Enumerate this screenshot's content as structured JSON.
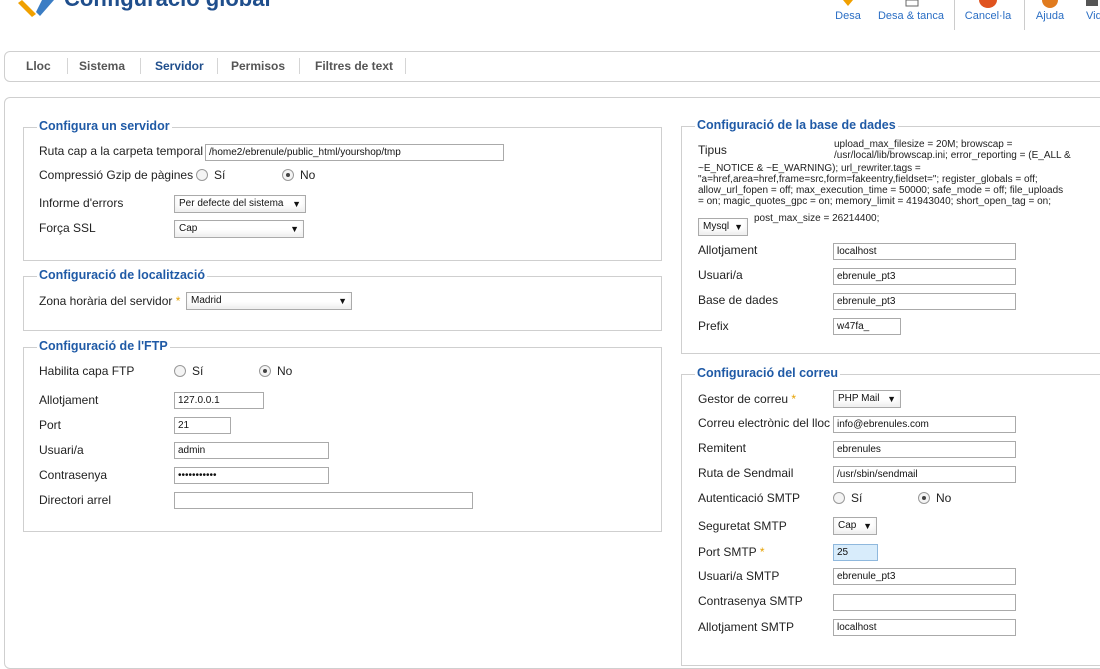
{
  "header": {
    "title": "Configuració global",
    "toolbar": {
      "save": "Desa",
      "save_close": "Desa & tanca",
      "cancel": "Cancel·la",
      "help": "Ajuda",
      "video": "Vid"
    }
  },
  "tabs": [
    "Lloc",
    "Sistema",
    "Servidor",
    "Permisos",
    "Filtres de text"
  ],
  "active_tab": "Servidor",
  "server": {
    "legend": "Configura un servidor",
    "tmp_path_label": "Ruta cap a la carpeta temporal",
    "tmp_path_value": "/home2/ebrenule/public_html/yourshop/tmp",
    "gzip_label": "Compressió Gzip de pàgines",
    "gzip_yes": "Sí",
    "gzip_no": "No",
    "gzip_selected": "No",
    "errors_label": "Informe d'errors",
    "errors_value": "Per defecte del sistema",
    "ssl_label": "Força SSL",
    "ssl_value": "Cap"
  },
  "locale": {
    "legend": "Configuració de localització",
    "tz_label": "Zona horària del servidor",
    "tz_value": "Madrid"
  },
  "ftp": {
    "legend": "Configuració de l'FTP",
    "enable_label": "Habilita capa FTP",
    "yes": "Sí",
    "no": "No",
    "selected": "No",
    "host_label": "Allotjament",
    "host_value": "127.0.0.1",
    "port_label": "Port",
    "port_value": "21",
    "user_label": "Usuari/a",
    "user_value": "admin",
    "pass_label": "Contrasenya",
    "pass_value": "•••••••••••",
    "root_label": "Directori arrel",
    "root_value": ""
  },
  "database": {
    "legend": "Configuració de la base de dades",
    "type_label": "Tipus",
    "type_info_1": "upload_max_filesize = 20M; browscap =",
    "type_info_2": "/usr/local/lib/browscap.ini; error_reporting = (E_ALL &",
    "type_info_3": "~E_NOTICE & ~E_WARNING); url_rewriter.tags =",
    "type_info_4": "\"a=href,area=href,frame=src,form=fakeentry,fieldset=\"; register_globals = off;",
    "type_info_5": "allow_url_fopen = off; max_execution_time = 50000; safe_mode = off; file_uploads",
    "type_info_6": "= on; magic_quotes_gpc = on; memory_limit = 41943040; short_open_tag = on;",
    "type_info_7": "post_max_size = 26214400;",
    "type_value": "Mysql",
    "host_label": "Allotjament",
    "host_value": "localhost",
    "user_label": "Usuari/a",
    "user_value": "ebrenule_pt3",
    "db_label": "Base de dades",
    "db_value": "ebrenule_pt3",
    "prefix_label": "Prefix",
    "prefix_value": "w47fa_"
  },
  "mail": {
    "legend": "Configuració del correu",
    "mailer_label": "Gestor de correu",
    "mailer_value": "PHP Mail",
    "from_email_label": "Correu electrònic del lloc",
    "from_email_value": "info@ebrenules.com",
    "from_name_label": "Remitent",
    "from_name_value": "ebrenules",
    "sendmail_label": "Ruta de Sendmail",
    "sendmail_value": "/usr/sbin/sendmail",
    "smtp_auth_label": "Autenticació SMTP",
    "smtp_auth_yes": "Sí",
    "smtp_auth_no": "No",
    "smtp_auth_selected": "No",
    "smtp_secure_label": "Seguretat SMTP",
    "smtp_secure_value": "Cap",
    "smtp_port_label": "Port SMTP",
    "smtp_port_value": "25",
    "smtp_user_label": "Usuari/a SMTP",
    "smtp_user_value": "ebrenule_pt3",
    "smtp_pass_label": "Contrasenya SMTP",
    "smtp_pass_value": "",
    "smtp_host_label": "Allotjament SMTP",
    "smtp_host_value": "localhost"
  },
  "colors": {
    "accent": "#1f5aa6",
    "title": "#1f4e8c",
    "required": "#e6a100",
    "cancel_icon": "#e0531f"
  }
}
